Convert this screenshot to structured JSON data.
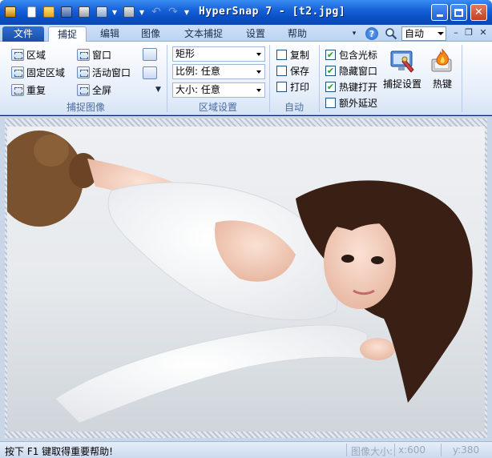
{
  "window": {
    "title": "HyperSnap 7 - [t2.jpg]"
  },
  "tabs": {
    "file": "文件",
    "capture": "捕捉",
    "edit": "编辑",
    "image": "图像",
    "text_capture": "文本捕捉",
    "settings": "设置",
    "help": "帮助"
  },
  "zoom": {
    "value": "自动"
  },
  "capture_group": {
    "title": "捕捉图像",
    "region": "区域",
    "fixed_region": "固定区域",
    "repeat": "重复",
    "window": "窗口",
    "active_window": "活动窗口",
    "full_screen": "全屏"
  },
  "region_settings": {
    "title": "区域设置",
    "shape": "矩形",
    "ratio": "比例: 任意",
    "size": "大小: 任意"
  },
  "auto_group": {
    "title": "自动",
    "copy": {
      "label": "复制",
      "checked": false
    },
    "save": {
      "label": "保存",
      "checked": false
    },
    "print": {
      "label": "打印",
      "checked": false
    }
  },
  "options": {
    "include_cursor": {
      "label": "包含光标",
      "checked": true
    },
    "hide_window": {
      "label": "隐藏窗口",
      "checked": true
    },
    "hotkeys_on": {
      "label": "热键打开",
      "checked": true
    },
    "extra_delay": {
      "label": "额外延迟",
      "checked": false
    }
  },
  "buttons": {
    "capture_settings": "捕捉设置",
    "hotkeys": "热键"
  },
  "statusbar": {
    "help_text": "按下 F1 键取得重要帮助!",
    "image_size_label": "图像大小:",
    "x": "x:600",
    "y": "y:380"
  },
  "colors": {
    "titlebar": "#1762d9",
    "ribbon_bg": "#e6eefa",
    "check_mark": "#21a121"
  }
}
